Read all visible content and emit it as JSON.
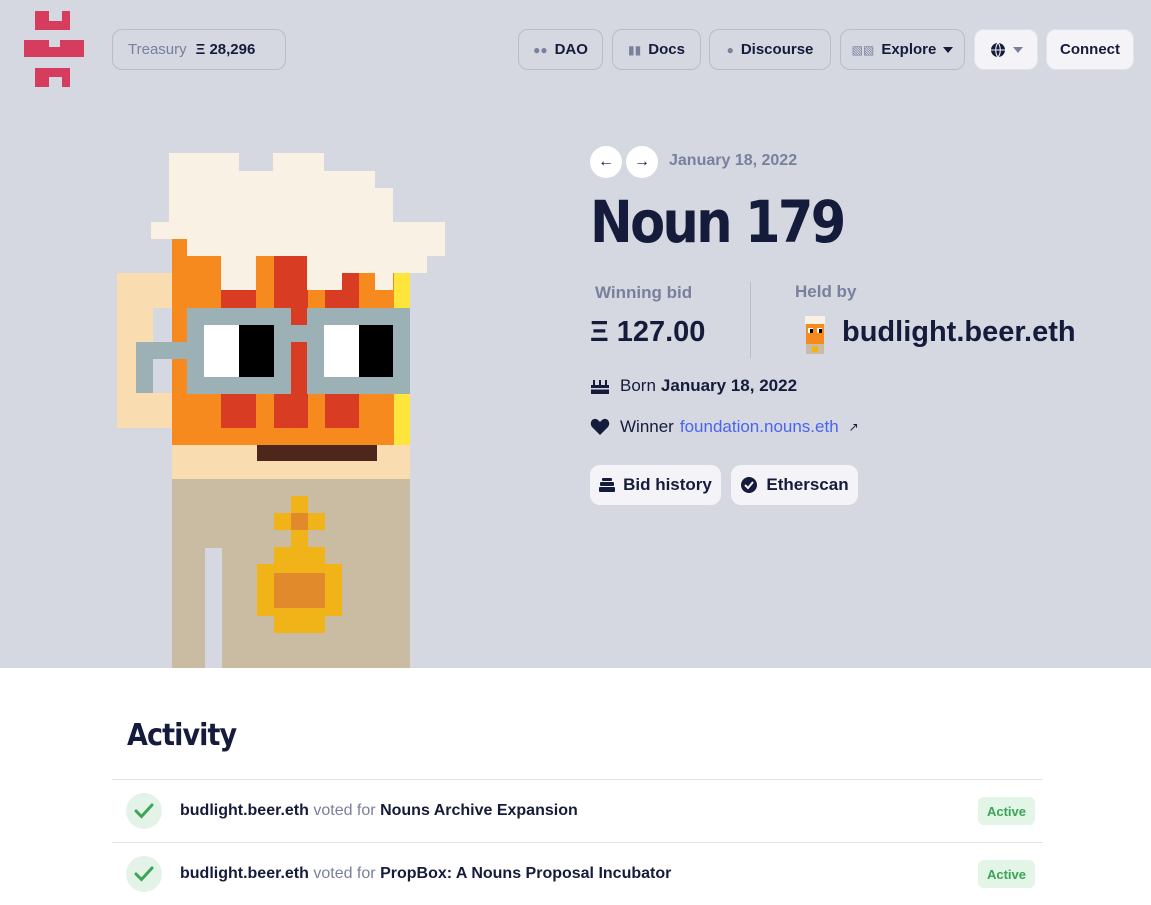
{
  "nav": {
    "treasury_label": "Treasury",
    "treasury_value": "Ξ 28,296",
    "dao_label": "DAO",
    "docs_label": "Docs",
    "discourse_label": "Discourse",
    "explore_label": "Explore",
    "connect_label": "Connect"
  },
  "auction": {
    "date": "January 18, 2022",
    "title": "Noun 179",
    "winning_bid_label": "Winning bid",
    "winning_bid_value": "Ξ 127.00",
    "held_by_label": "Held by",
    "holder": "budlight.beer.eth",
    "born_label": "Born",
    "born_date": "January 18, 2022",
    "winner_label": "Winner",
    "winner_address": "foundation.nouns.eth",
    "bid_history_label": "Bid history",
    "etherscan_label": "Etherscan"
  },
  "activity": {
    "title": "Activity",
    "items": [
      {
        "voter": "budlight.beer.eth",
        "action": "voted for",
        "proposal": "Nouns Archive Expansion",
        "status": "Active"
      },
      {
        "voter": "budlight.beer.eth",
        "action": "voted for",
        "proposal": "PropBox: A Nouns Proposal Incubator",
        "status": "Active"
      }
    ]
  },
  "colors": {
    "hero_bg": "#d5d7e1",
    "brand_red": "#d63c5e",
    "link_blue": "#4965f0",
    "active_green": "#3ba555"
  },
  "icons": [
    "nouns-logo-icon",
    "users-icon",
    "book-icon",
    "chat-icon",
    "explore-icon",
    "globe-icon",
    "arrow-left-icon",
    "arrow-right-icon",
    "cake-icon",
    "heart-icon",
    "external-link-icon",
    "stack-icon",
    "check-badge-icon",
    "check-icon"
  ]
}
